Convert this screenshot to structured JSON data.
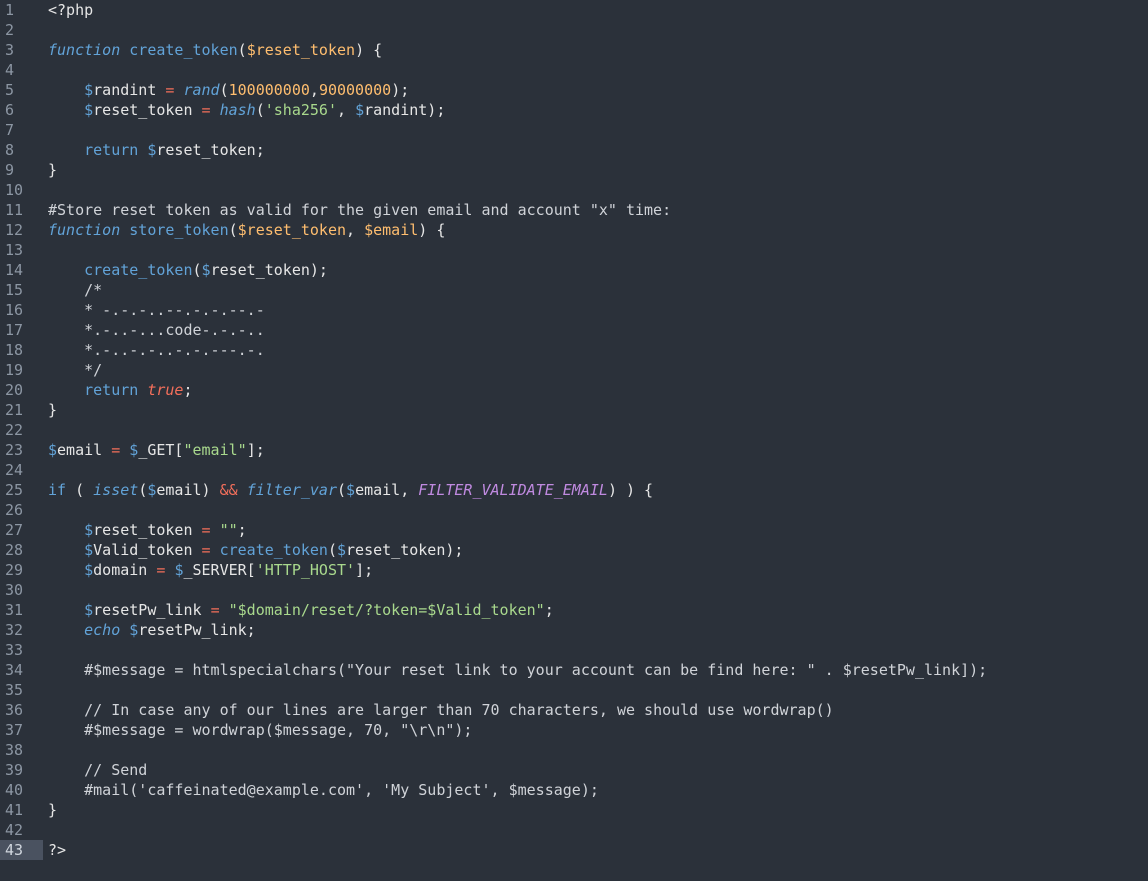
{
  "editor": {
    "language": "php",
    "current_line": 43,
    "colors": {
      "background": "#2b313a",
      "gutter_text": "#8c96a3",
      "current_line_gutter": "#4a5260",
      "plain": "#e6e6e6",
      "keyword": "#62a3d8",
      "param": "#ffbe6f",
      "string": "#a9d98d",
      "operator": "#f46f5b",
      "constant": "#c08ae0"
    },
    "lines": [
      {
        "n": "1",
        "tokens": [
          {
            "t": "plain",
            "v": "<?php"
          }
        ]
      },
      {
        "n": "2",
        "tokens": []
      },
      {
        "n": "3",
        "tokens": [
          {
            "t": "fnkw",
            "v": "function"
          },
          {
            "t": "plain",
            "v": " "
          },
          {
            "t": "fn",
            "v": "create_token"
          },
          {
            "t": "plain",
            "v": "("
          },
          {
            "t": "param",
            "v": "$reset_token"
          },
          {
            "t": "plain",
            "v": ") {"
          }
        ]
      },
      {
        "n": "4",
        "tokens": []
      },
      {
        "n": "5",
        "tokens": [
          {
            "t": "plain",
            "v": "    "
          },
          {
            "t": "var",
            "v": "$"
          },
          {
            "t": "plain",
            "v": "randint "
          },
          {
            "t": "op",
            "v": "="
          },
          {
            "t": "plain",
            "v": " "
          },
          {
            "t": "bi",
            "v": "rand"
          },
          {
            "t": "plain",
            "v": "("
          },
          {
            "t": "num",
            "v": "100000000"
          },
          {
            "t": "plain",
            "v": ","
          },
          {
            "t": "num",
            "v": "90000000"
          },
          {
            "t": "plain",
            "v": ");"
          }
        ]
      },
      {
        "n": "6",
        "tokens": [
          {
            "t": "plain",
            "v": "    "
          },
          {
            "t": "var",
            "v": "$"
          },
          {
            "t": "plain",
            "v": "reset_token "
          },
          {
            "t": "op",
            "v": "="
          },
          {
            "t": "plain",
            "v": " "
          },
          {
            "t": "bi",
            "v": "hash"
          },
          {
            "t": "plain",
            "v": "("
          },
          {
            "t": "str",
            "v": "'sha256'"
          },
          {
            "t": "plain",
            "v": ", "
          },
          {
            "t": "var",
            "v": "$"
          },
          {
            "t": "plain",
            "v": "randint);"
          }
        ]
      },
      {
        "n": "7",
        "tokens": []
      },
      {
        "n": "8",
        "tokens": [
          {
            "t": "plain",
            "v": "    "
          },
          {
            "t": "kw",
            "v": "return"
          },
          {
            "t": "plain",
            "v": " "
          },
          {
            "t": "var",
            "v": "$"
          },
          {
            "t": "plain",
            "v": "reset_token;"
          }
        ]
      },
      {
        "n": "9",
        "tokens": [
          {
            "t": "plain",
            "v": "}"
          }
        ]
      },
      {
        "n": "10",
        "tokens": []
      },
      {
        "n": "11",
        "tokens": [
          {
            "t": "comment",
            "v": "#Store reset token as valid for the given email and account \"x\" time:"
          }
        ]
      },
      {
        "n": "12",
        "tokens": [
          {
            "t": "fnkw",
            "v": "function"
          },
          {
            "t": "plain",
            "v": " "
          },
          {
            "t": "fn",
            "v": "store_token"
          },
          {
            "t": "plain",
            "v": "("
          },
          {
            "t": "param",
            "v": "$reset_token"
          },
          {
            "t": "plain",
            "v": ", "
          },
          {
            "t": "param",
            "v": "$email"
          },
          {
            "t": "plain",
            "v": ") {"
          }
        ]
      },
      {
        "n": "13",
        "tokens": []
      },
      {
        "n": "14",
        "tokens": [
          {
            "t": "plain",
            "v": "    "
          },
          {
            "t": "fn",
            "v": "create_token"
          },
          {
            "t": "plain",
            "v": "("
          },
          {
            "t": "var",
            "v": "$"
          },
          {
            "t": "plain",
            "v": "reset_token);"
          }
        ]
      },
      {
        "n": "15",
        "tokens": [
          {
            "t": "plain",
            "v": "    "
          },
          {
            "t": "comment",
            "v": "/*"
          }
        ]
      },
      {
        "n": "16",
        "tokens": [
          {
            "t": "plain",
            "v": "    "
          },
          {
            "t": "comment",
            "v": "* -.-.-..--.-.-.--.-"
          }
        ]
      },
      {
        "n": "17",
        "tokens": [
          {
            "t": "plain",
            "v": "    "
          },
          {
            "t": "comment",
            "v": "*.-..-...code-.-.-.."
          }
        ]
      },
      {
        "n": "18",
        "tokens": [
          {
            "t": "plain",
            "v": "    "
          },
          {
            "t": "comment",
            "v": "*.-..-.-..-.-.---.-."
          }
        ]
      },
      {
        "n": "19",
        "tokens": [
          {
            "t": "plain",
            "v": "    "
          },
          {
            "t": "comment",
            "v": "*/"
          }
        ]
      },
      {
        "n": "20",
        "tokens": [
          {
            "t": "plain",
            "v": "    "
          },
          {
            "t": "kw",
            "v": "return"
          },
          {
            "t": "plain",
            "v": " "
          },
          {
            "t": "bool",
            "v": "true"
          },
          {
            "t": "plain",
            "v": ";"
          }
        ]
      },
      {
        "n": "21",
        "tokens": [
          {
            "t": "plain",
            "v": "}"
          }
        ]
      },
      {
        "n": "22",
        "tokens": []
      },
      {
        "n": "23",
        "tokens": [
          {
            "t": "var",
            "v": "$"
          },
          {
            "t": "plain",
            "v": "email "
          },
          {
            "t": "op",
            "v": "="
          },
          {
            "t": "plain",
            "v": " "
          },
          {
            "t": "var",
            "v": "$"
          },
          {
            "t": "plain",
            "v": "_GET["
          },
          {
            "t": "str",
            "v": "\"email\""
          },
          {
            "t": "plain",
            "v": "];"
          }
        ]
      },
      {
        "n": "24",
        "tokens": []
      },
      {
        "n": "25",
        "tokens": [
          {
            "t": "kw",
            "v": "if"
          },
          {
            "t": "plain",
            "v": " ( "
          },
          {
            "t": "bi",
            "v": "isset"
          },
          {
            "t": "plain",
            "v": "("
          },
          {
            "t": "var",
            "v": "$"
          },
          {
            "t": "plain",
            "v": "email) "
          },
          {
            "t": "op",
            "v": "&&"
          },
          {
            "t": "plain",
            "v": " "
          },
          {
            "t": "bi",
            "v": "filter_var"
          },
          {
            "t": "plain",
            "v": "("
          },
          {
            "t": "var",
            "v": "$"
          },
          {
            "t": "plain",
            "v": "email, "
          },
          {
            "t": "const",
            "v": "FILTER_VALIDATE_EMAIL"
          },
          {
            "t": "plain",
            "v": ") ) {"
          }
        ]
      },
      {
        "n": "26",
        "tokens": []
      },
      {
        "n": "27",
        "tokens": [
          {
            "t": "plain",
            "v": "    "
          },
          {
            "t": "var",
            "v": "$"
          },
          {
            "t": "plain",
            "v": "reset_token "
          },
          {
            "t": "op",
            "v": "="
          },
          {
            "t": "plain",
            "v": " "
          },
          {
            "t": "str",
            "v": "\"\""
          },
          {
            "t": "plain",
            "v": ";"
          }
        ]
      },
      {
        "n": "28",
        "tokens": [
          {
            "t": "plain",
            "v": "    "
          },
          {
            "t": "var",
            "v": "$"
          },
          {
            "t": "plain",
            "v": "Valid_token "
          },
          {
            "t": "op",
            "v": "="
          },
          {
            "t": "plain",
            "v": " "
          },
          {
            "t": "fn",
            "v": "create_token"
          },
          {
            "t": "plain",
            "v": "("
          },
          {
            "t": "var",
            "v": "$"
          },
          {
            "t": "plain",
            "v": "reset_token);"
          }
        ]
      },
      {
        "n": "29",
        "tokens": [
          {
            "t": "plain",
            "v": "    "
          },
          {
            "t": "var",
            "v": "$"
          },
          {
            "t": "plain",
            "v": "domain "
          },
          {
            "t": "op",
            "v": "="
          },
          {
            "t": "plain",
            "v": " "
          },
          {
            "t": "var",
            "v": "$"
          },
          {
            "t": "plain",
            "v": "_SERVER["
          },
          {
            "t": "str",
            "v": "'HTTP_HOST'"
          },
          {
            "t": "plain",
            "v": "];"
          }
        ]
      },
      {
        "n": "30",
        "tokens": []
      },
      {
        "n": "31",
        "tokens": [
          {
            "t": "plain",
            "v": "    "
          },
          {
            "t": "var",
            "v": "$"
          },
          {
            "t": "plain",
            "v": "resetPw_link "
          },
          {
            "t": "op",
            "v": "="
          },
          {
            "t": "plain",
            "v": " "
          },
          {
            "t": "str",
            "v": "\"$domain/reset/?token=$Valid_token\""
          },
          {
            "t": "plain",
            "v": ";"
          }
        ]
      },
      {
        "n": "32",
        "tokens": [
          {
            "t": "plain",
            "v": "    "
          },
          {
            "t": "fnkw",
            "v": "echo"
          },
          {
            "t": "plain",
            "v": " "
          },
          {
            "t": "var",
            "v": "$"
          },
          {
            "t": "plain",
            "v": "resetPw_link;"
          }
        ]
      },
      {
        "n": "33",
        "tokens": []
      },
      {
        "n": "34",
        "tokens": [
          {
            "t": "plain",
            "v": "    "
          },
          {
            "t": "comment",
            "v": "#$message = htmlspecialchars(\"Your reset link to your account can be find here: \" . $resetPw_link]);"
          }
        ]
      },
      {
        "n": "35",
        "tokens": []
      },
      {
        "n": "36",
        "tokens": [
          {
            "t": "plain",
            "v": "    "
          },
          {
            "t": "comment",
            "v": "// In case any of our lines are larger than 70 characters, we should use wordwrap()"
          }
        ]
      },
      {
        "n": "37",
        "tokens": [
          {
            "t": "plain",
            "v": "    "
          },
          {
            "t": "comment",
            "v": "#$message = wordwrap($message, 70, \"\\r\\n\");"
          }
        ]
      },
      {
        "n": "38",
        "tokens": []
      },
      {
        "n": "39",
        "tokens": [
          {
            "t": "plain",
            "v": "    "
          },
          {
            "t": "comment",
            "v": "// Send"
          }
        ]
      },
      {
        "n": "40",
        "tokens": [
          {
            "t": "plain",
            "v": "    "
          },
          {
            "t": "comment",
            "v": "#mail('caffeinated@example.com', 'My Subject', $message);"
          }
        ]
      },
      {
        "n": "41",
        "tokens": [
          {
            "t": "plain",
            "v": "}"
          }
        ]
      },
      {
        "n": "42",
        "tokens": []
      },
      {
        "n": "43",
        "tokens": [
          {
            "t": "plain",
            "v": "?>"
          }
        ]
      }
    ]
  }
}
